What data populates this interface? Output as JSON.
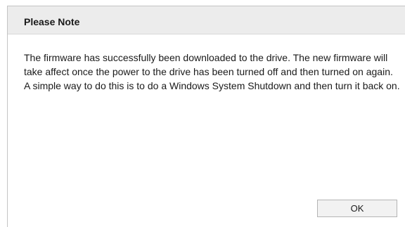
{
  "dialog": {
    "title": "Please Note",
    "message": "The firmware has successfully been downloaded to the drive. The new firmware will take affect once the power to the drive has been turned off and then turned on again. A simple way to do this is to do a Windows System Shutdown and then turn it back on.",
    "ok_label": "OK"
  }
}
